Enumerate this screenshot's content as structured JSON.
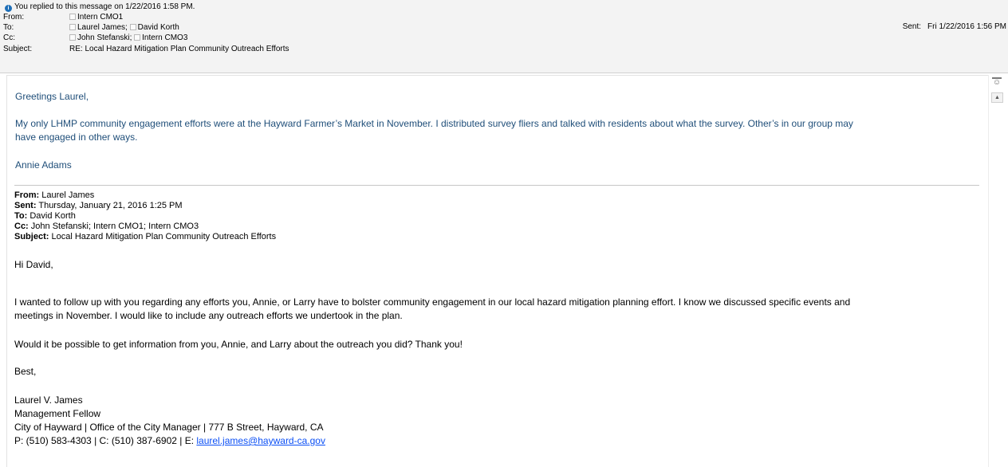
{
  "header": {
    "reply_notice": "You replied to this message on 1/22/2016 1:58 PM.",
    "from_label": "From:",
    "from_value": "Intern CMO1",
    "to_label": "To:",
    "to_1": "Laurel James;",
    "to_2": "David Korth",
    "cc_label": "Cc:",
    "cc_1": "John Stefanski;",
    "cc_2": "Intern CMO3",
    "subject_label": "Subject:",
    "subject_value": "RE: Local Hazard Mitigation Plan Community Outreach Efforts",
    "sent_label": "Sent:",
    "sent_value": "Fri 1/22/2016 1:56 PM"
  },
  "reply": {
    "greeting": "Greetings Laurel,",
    "para_line1": "My only LHMP community engagement efforts were at the Hayward Farmer’s Market in November.  I distributed survey fliers and talked with residents about what the survey.  Other’s in our group may",
    "para_line2": "have engaged in other ways.",
    "signature": "Annie Adams"
  },
  "original": {
    "from_label": "From:",
    "from_value": " Laurel James",
    "sent_label": "Sent:",
    "sent_value": " Thursday, January 21, 2016 1:25 PM",
    "to_label": "To:",
    "to_value": " David Korth",
    "cc_label": "Cc:",
    "cc_value": " John Stefanski; Intern CMO1; Intern CMO3",
    "subject_label": "Subject:",
    "subject_value": " Local Hazard Mitigation Plan Community Outreach Efforts",
    "greeting": "Hi David,",
    "para1_line1": "I wanted to follow up with you regarding any efforts you, Annie, or Larry have to bolster community engagement in our local hazard mitigation planning effort. I know we discussed specific events and",
    "para1_line2": "meetings in November. I would like to include any outreach efforts we undertook in the plan.",
    "para2": "Would it be possible to get information from you, Annie, and Larry about the outreach you did? Thank you!",
    "closing": "Best,",
    "sig_name": "Laurel V. James",
    "sig_title": "Management Fellow",
    "sig_org": "City of Hayward | Office of the City Manager | 777 B Street, Hayward, CA",
    "sig_phone": "P: (510) 583-4303 | C: (510) 387-6902 | E: ",
    "sig_email": "laurel.james@hayward-ca.gov"
  },
  "icons": {
    "info": "info-icon",
    "person": "person-chip-icon",
    "scroll_up": "scroll-up-icon"
  },
  "colors": {
    "reply_text": "#1f4e79",
    "link": "#0b4ff5",
    "info_icon": "#1e6fb8"
  }
}
